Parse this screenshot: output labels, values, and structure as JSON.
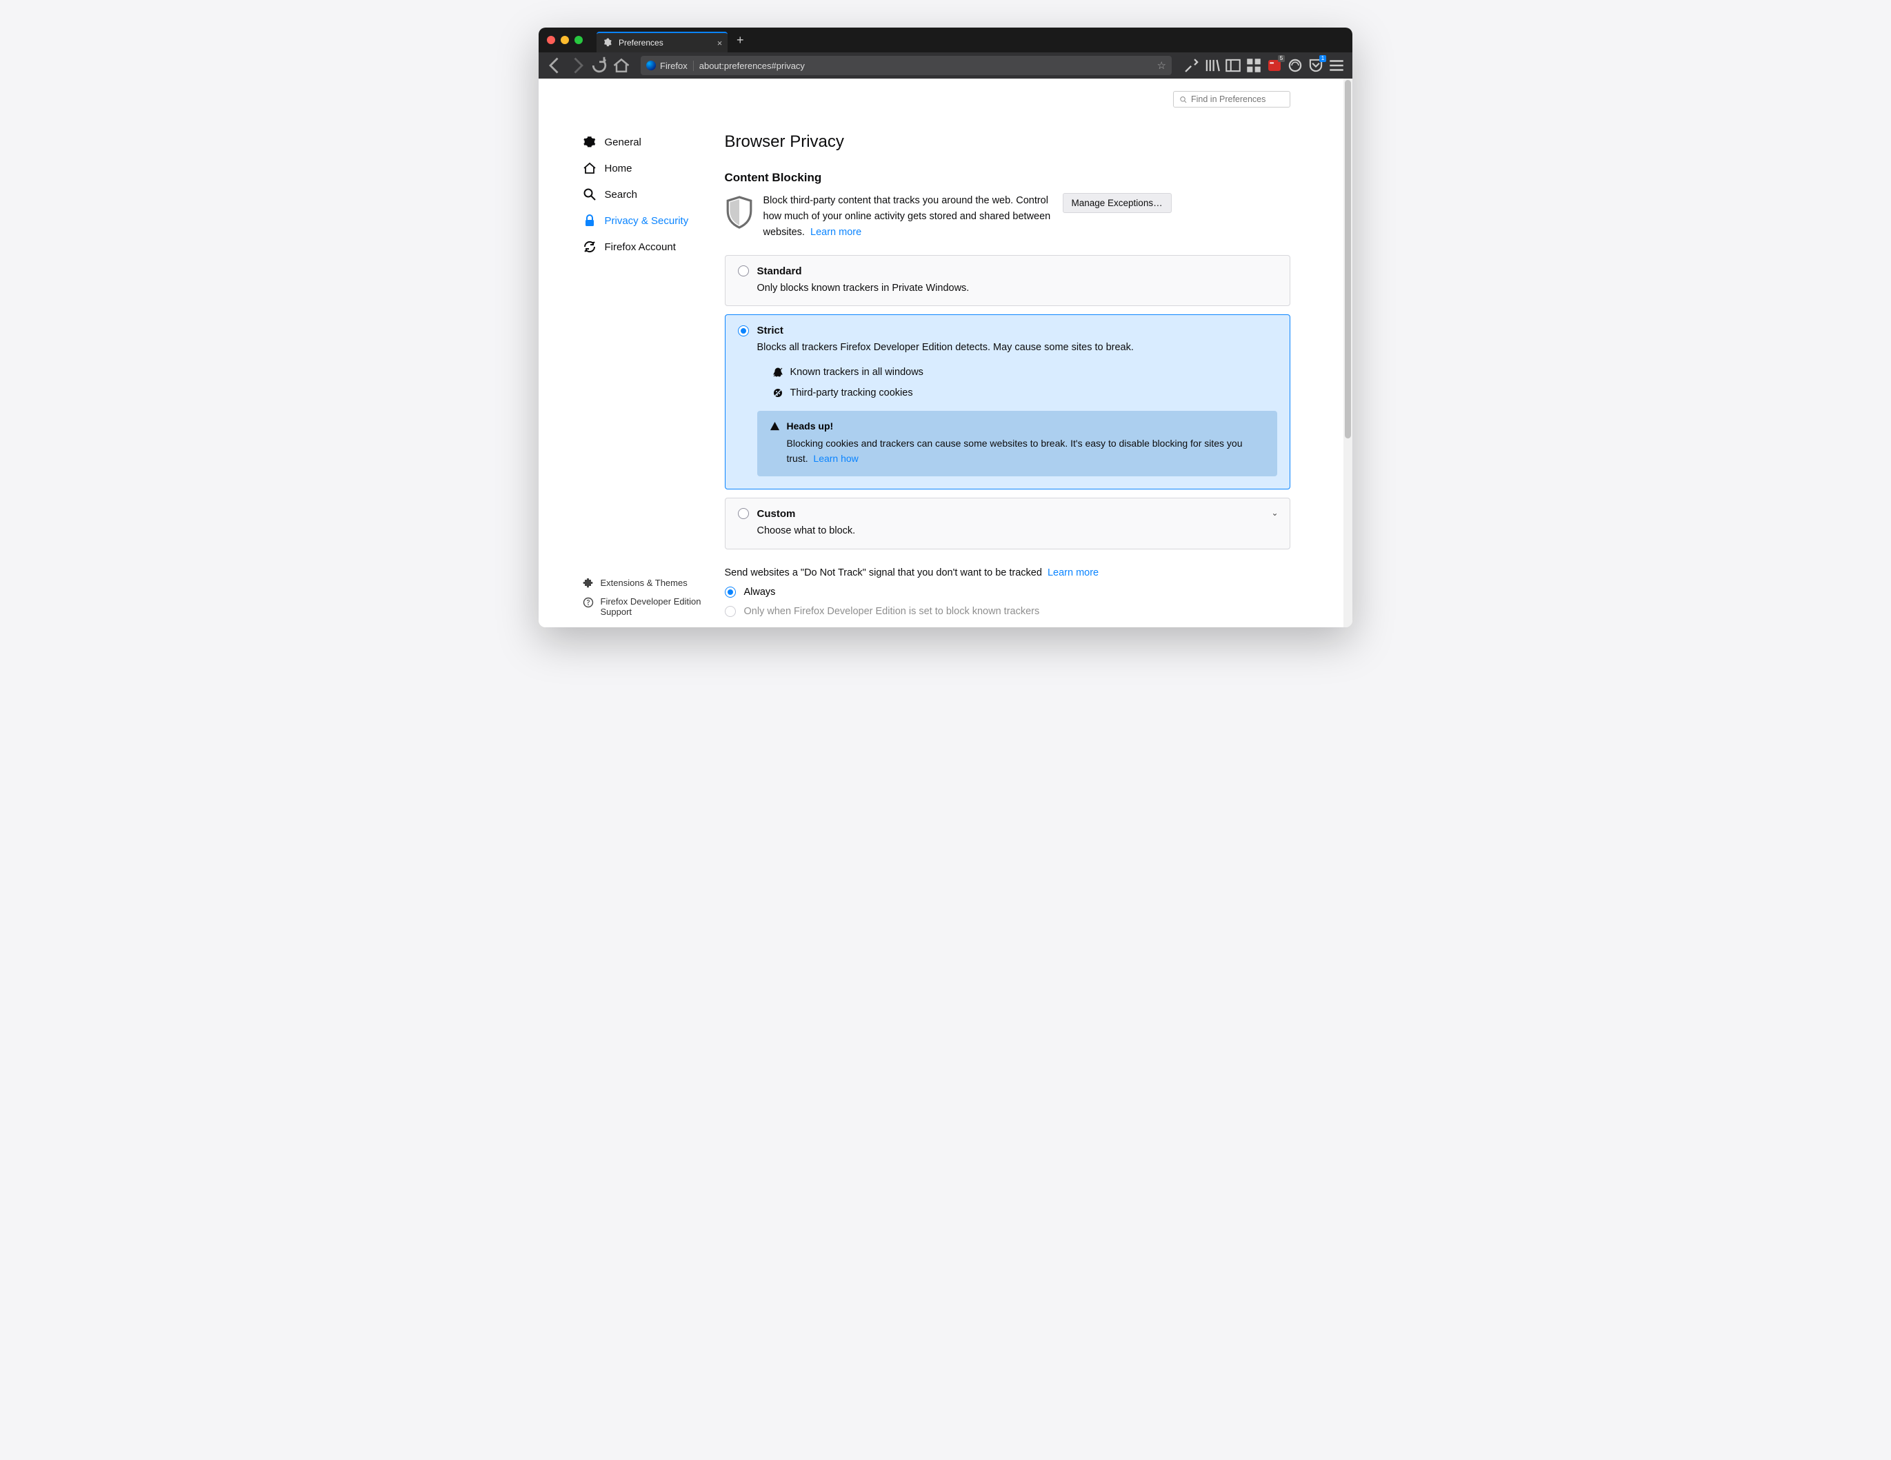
{
  "titlebar": {
    "tab_title": "Preferences"
  },
  "urlbar": {
    "identity": "Firefox",
    "url": "about:preferences#privacy"
  },
  "toolbar_badges": {
    "lastpass": "5",
    "inbox": "1"
  },
  "search": {
    "placeholder": "Find in Preferences"
  },
  "sidebar": {
    "items": [
      {
        "label": "General"
      },
      {
        "label": "Home"
      },
      {
        "label": "Search"
      },
      {
        "label": "Privacy & Security"
      },
      {
        "label": "Firefox Account"
      }
    ],
    "footer": {
      "extensions": "Extensions & Themes",
      "support": "Firefox Developer Edition Support"
    }
  },
  "main": {
    "title": "Browser Privacy",
    "cb": {
      "heading": "Content Blocking",
      "desc": "Block third-party content that tracks you around the web. Control how much of your online activity gets stored and shared between websites.",
      "learn_more": "Learn more",
      "manage": "Manage Exceptions…"
    },
    "options": {
      "standard": {
        "title": "Standard",
        "sub": "Only blocks known trackers in Private Windows."
      },
      "strict": {
        "title": "Strict",
        "sub": "Blocks all trackers Firefox Developer Edition detects. May cause some sites to break.",
        "items": [
          "Known trackers in all windows",
          "Third-party tracking cookies"
        ],
        "heads_title": "Heads up!",
        "heads_body": "Blocking cookies and trackers can cause some websites to break. It's easy to disable blocking for sites you trust.",
        "heads_link": "Learn how"
      },
      "custom": {
        "title": "Custom",
        "sub": "Choose what to block."
      }
    },
    "dnt": {
      "text": "Send websites a \"Do Not Track\" signal that you don't want to be tracked",
      "link": "Learn more",
      "opt_always": "Always",
      "opt_only": "Only when Firefox Developer Edition is set to block known trackers"
    }
  }
}
